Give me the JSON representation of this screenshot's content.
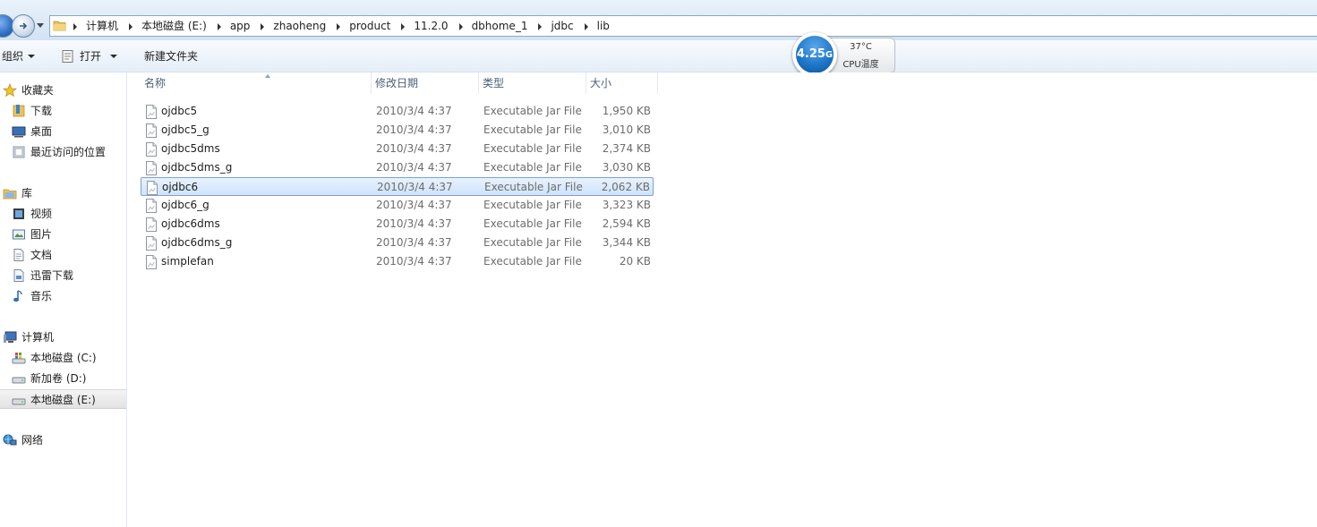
{
  "address_bar": {
    "crumbs": [
      "计算机",
      "本地磁盘 (E:)",
      "app",
      "zhaoheng",
      "product",
      "11.2.0",
      "dbhome_1",
      "jdbc",
      "lib"
    ]
  },
  "toolbar": {
    "organize_label": "组织",
    "open_label": "打开",
    "new_folder_label": "新建文件夹"
  },
  "gadget": {
    "speed": "4.25",
    "speed_unit": "G",
    "temperature": "37°C",
    "label": "CPU温度"
  },
  "nav": {
    "favorites": {
      "label": "收藏夹",
      "items": [
        "下载",
        "桌面",
        "最近访问的位置"
      ]
    },
    "libraries": {
      "label": "库",
      "items": [
        "视频",
        "图片",
        "文档",
        "迅雷下载",
        "音乐"
      ]
    },
    "computer": {
      "label": "计算机",
      "items": [
        "本地磁盘 (C:)",
        "新加卷 (D:)",
        "本地磁盘 (E:)"
      ]
    },
    "network": {
      "label": "网络"
    }
  },
  "columns": {
    "name": "名称",
    "date": "修改日期",
    "type": "类型",
    "size": "大小"
  },
  "files": [
    {
      "name": "ojdbc5",
      "date": "2010/3/4 4:37",
      "type": "Executable Jar File",
      "size": "1,950 KB"
    },
    {
      "name": "ojdbc5_g",
      "date": "2010/3/4 4:37",
      "type": "Executable Jar File",
      "size": "3,010 KB"
    },
    {
      "name": "ojdbc5dms",
      "date": "2010/3/4 4:37",
      "type": "Executable Jar File",
      "size": "2,374 KB"
    },
    {
      "name": "ojdbc5dms_g",
      "date": "2010/3/4 4:37",
      "type": "Executable Jar File",
      "size": "3,030 KB"
    },
    {
      "name": "ojdbc6",
      "date": "2010/3/4 4:37",
      "type": "Executable Jar File",
      "size": "2,062 KB"
    },
    {
      "name": "ojdbc6_g",
      "date": "2010/3/4 4:37",
      "type": "Executable Jar File",
      "size": "3,323 KB"
    },
    {
      "name": "ojdbc6dms",
      "date": "2010/3/4 4:37",
      "type": "Executable Jar File",
      "size": "2,594 KB"
    },
    {
      "name": "ojdbc6dms_g",
      "date": "2010/3/4 4:37",
      "type": "Executable Jar File",
      "size": "3,344 KB"
    },
    {
      "name": "simplefan",
      "date": "2010/3/4 4:37",
      "type": "Executable Jar File",
      "size": "20 KB"
    }
  ],
  "selected_file": "ojdbc6",
  "selected_nav": "本地磁盘 (E:)",
  "colors": {
    "accent": "#1f77c9",
    "selection_border": "#7da2ce",
    "selection_fill": "#cfe3fb"
  }
}
